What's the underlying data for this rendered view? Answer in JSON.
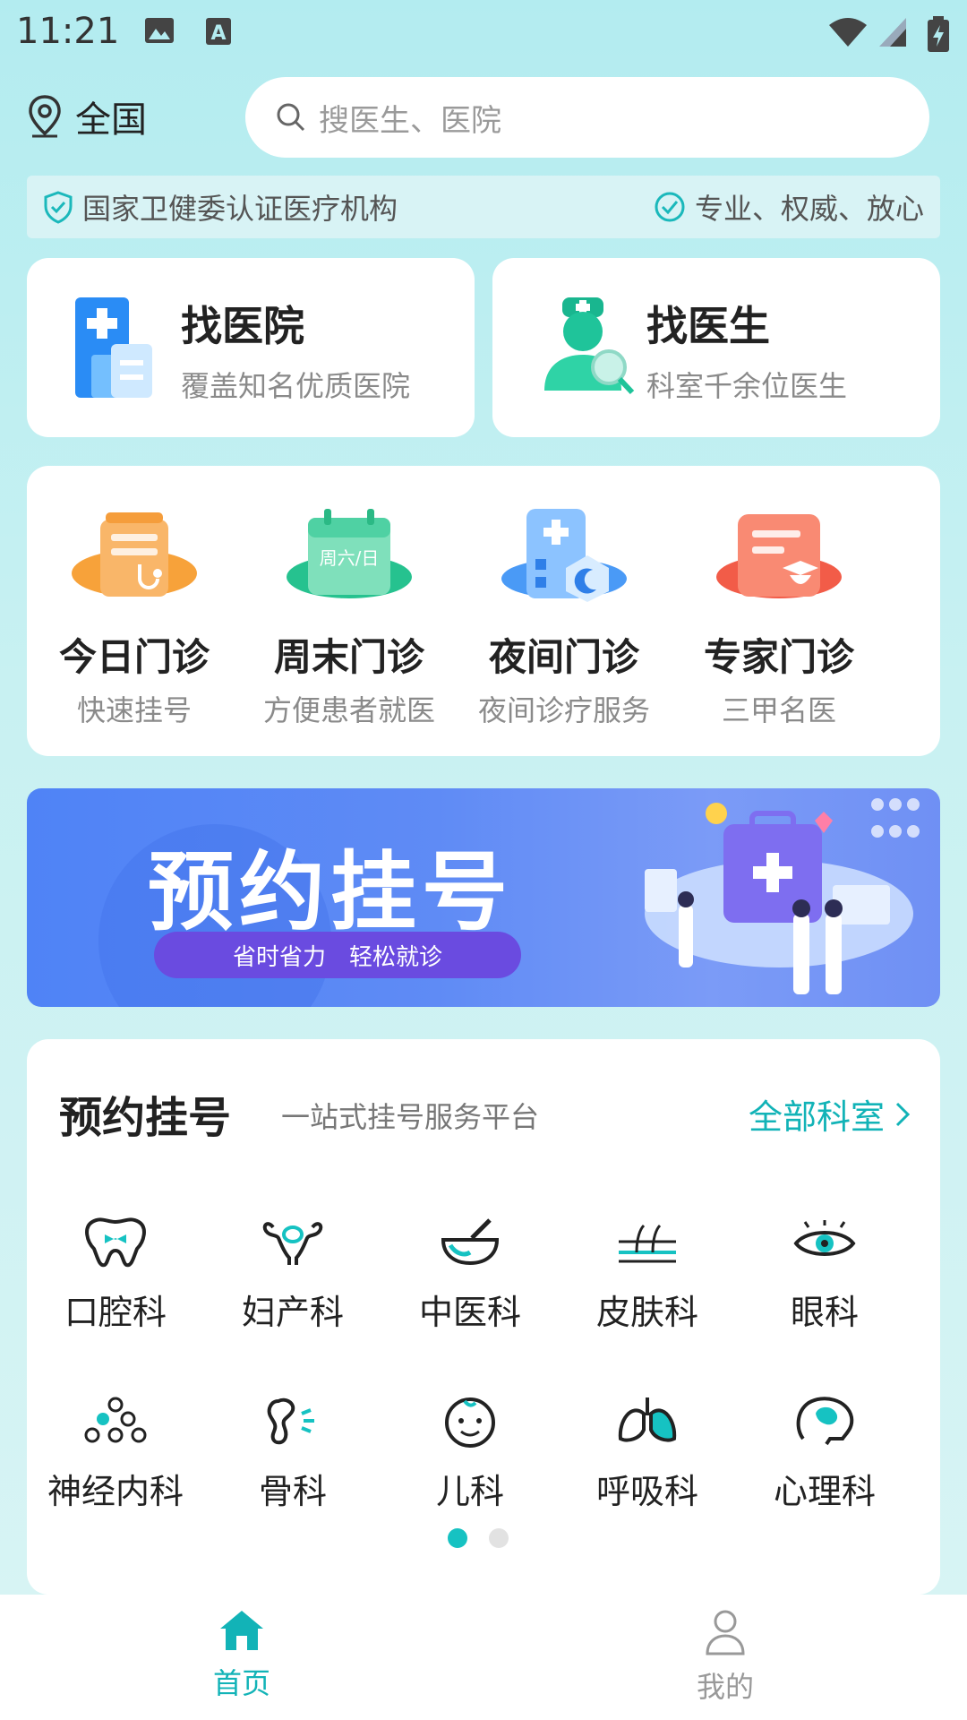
{
  "status_bar": {
    "time": "11:21"
  },
  "header": {
    "location": "全国",
    "search_placeholder": "搜医生、医院"
  },
  "cert": {
    "left": "国家卫健委认证医疗机构",
    "right": "专业、权威、放心"
  },
  "find_cards": [
    {
      "title": "找医院",
      "sub": "覆盖知名优质医院"
    },
    {
      "title": "找医生",
      "sub": "科室千余位医生"
    }
  ],
  "clinics": [
    {
      "name": "今日门诊",
      "desc": "快速挂号"
    },
    {
      "name": "周末门诊",
      "desc": "方便患者就医",
      "icon_text": "周六/日"
    },
    {
      "name": "夜间门诊",
      "desc": "夜间诊疗服务"
    },
    {
      "name": "专家门诊",
      "desc": "三甲名医"
    }
  ],
  "banner": {
    "title": "预约挂号",
    "tag1": "省时省力",
    "tag2": "轻松就诊"
  },
  "booking": {
    "title": "预约挂号",
    "subtitle": "一站式挂号服务平台",
    "all_link": "全部科室",
    "departments": [
      "口腔科",
      "妇产科",
      "中医科",
      "皮肤科",
      "眼科",
      "神经内科",
      "骨科",
      "儿科",
      "呼吸科",
      "心理科"
    ],
    "page_indicator": {
      "current": 1,
      "total": 2
    }
  },
  "nav": {
    "home": "首页",
    "mine": "我的"
  },
  "colors": {
    "accent": "#12b3b7",
    "bg": "#b3ecf0",
    "banner": "#5f8bf5"
  }
}
